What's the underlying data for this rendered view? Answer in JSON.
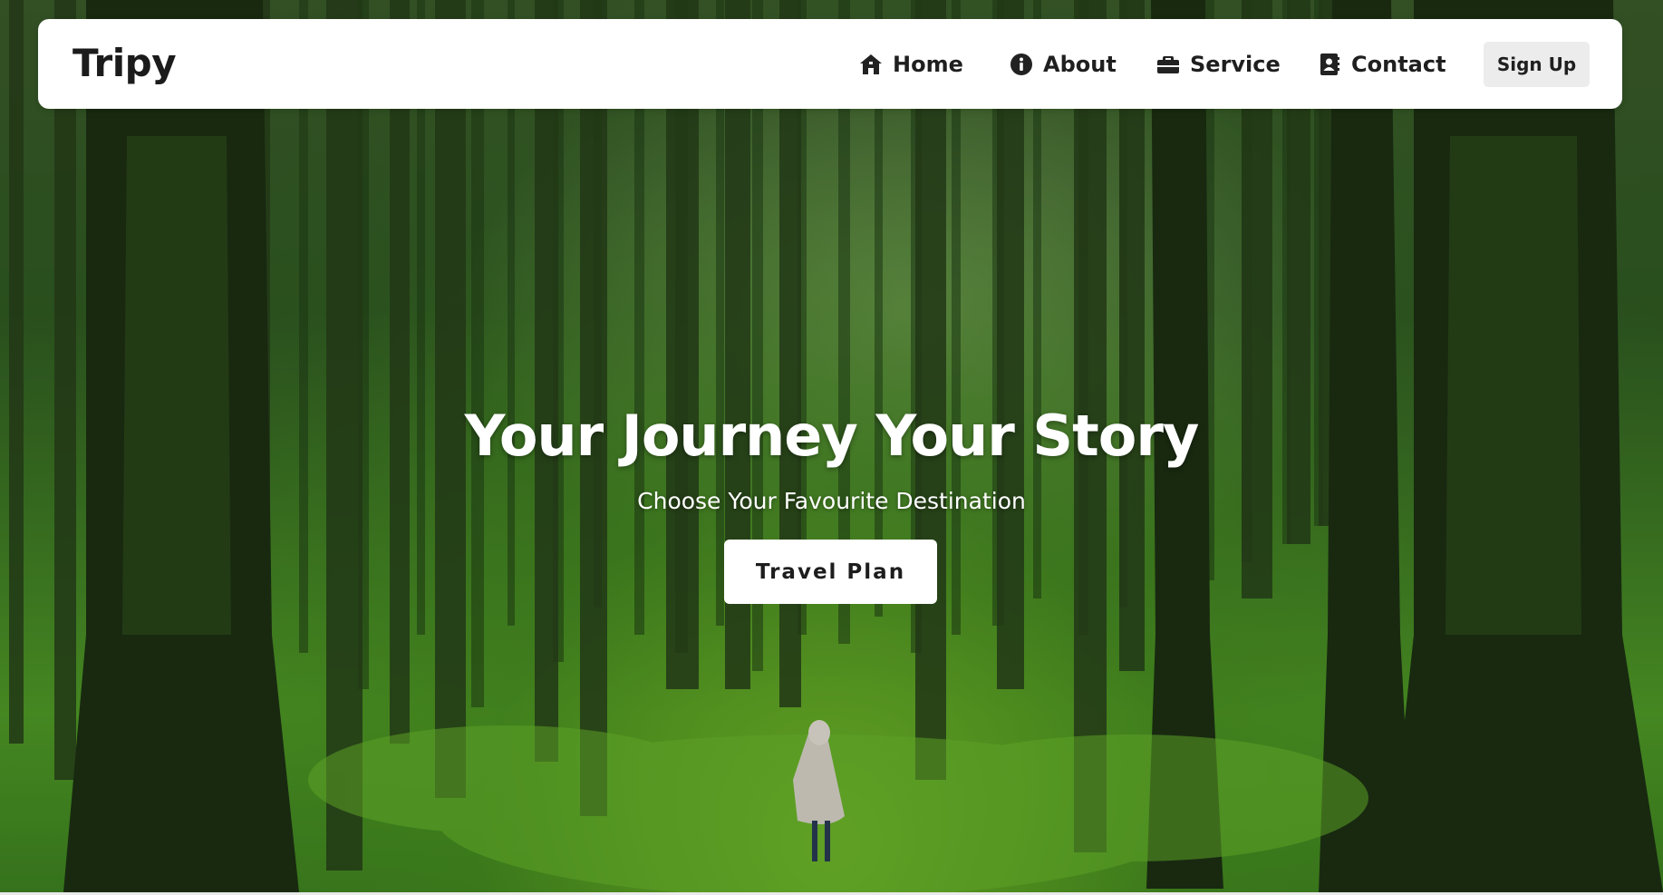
{
  "brand": {
    "name": "Tripy"
  },
  "nav": {
    "items": [
      {
        "label": "Home",
        "icon": "home-icon"
      },
      {
        "label": "About",
        "icon": "info-icon"
      },
      {
        "label": "Service",
        "icon": "briefcase-icon"
      },
      {
        "label": "Contact",
        "icon": "contact-card-icon"
      }
    ],
    "signup_label": "Sign Up"
  },
  "hero": {
    "headline": "Your Journey Your Story",
    "subline": "Choose Your Favourite Destination",
    "cta_label": "Travel Plan",
    "background": "forest-photo"
  },
  "colors": {
    "text_dark": "#1f1f1f",
    "nav_background": "#ffffff",
    "signup_background": "#ececec",
    "hero_text": "#ffffff",
    "forest_green": "#4f9a26"
  }
}
